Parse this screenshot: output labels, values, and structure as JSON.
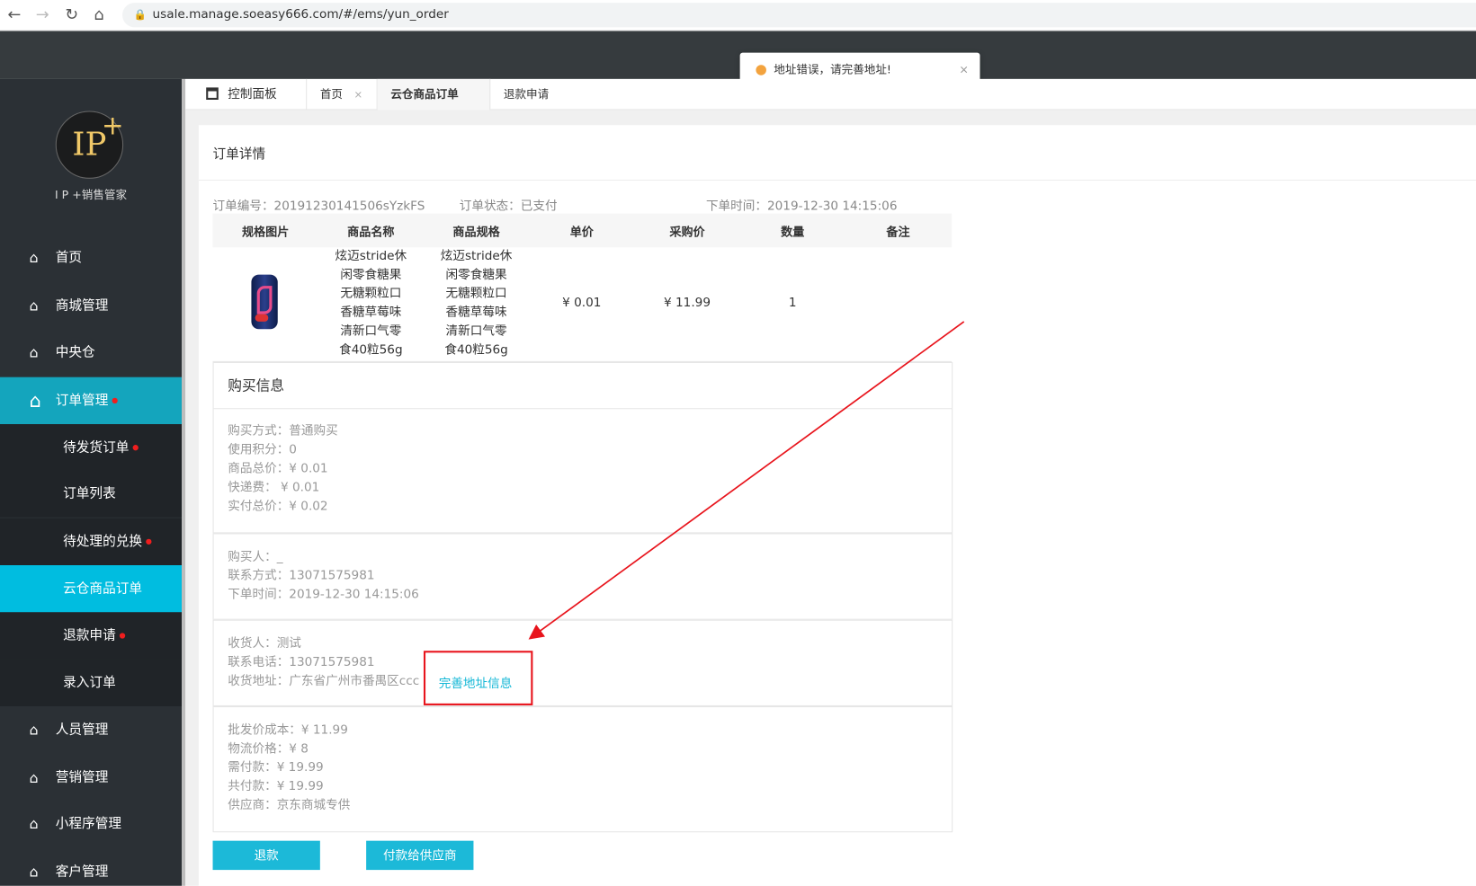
{
  "browser": {
    "url": "usale.manage.soeasy666.com/#/ems/yun_order"
  },
  "toast": {
    "message": "地址错误，请完善地址!",
    "close": "×",
    "color": "#f3a33e"
  },
  "logo": {
    "mark": "IP",
    "plus": "+",
    "name": "I P +销售管家"
  },
  "sidebar": {
    "items": [
      {
        "label": "首页",
        "icon": "home-icon"
      },
      {
        "label": "商城管理",
        "icon": "home-icon"
      },
      {
        "label": "中央仓",
        "icon": "home-icon"
      },
      {
        "label": "订单管理",
        "icon": "home-icon",
        "active": true,
        "dot": true
      },
      {
        "label": "待发货订单",
        "sub": true,
        "dot": true
      },
      {
        "label": "订单列表",
        "sub": true
      },
      {
        "label": "待处理的兑换",
        "sub": true,
        "dot": true
      },
      {
        "label": "云仓商品订单",
        "sub": true,
        "active": true
      },
      {
        "label": "退款申请",
        "sub": true,
        "dot": true
      },
      {
        "label": "录入订单",
        "sub": true
      },
      {
        "label": "人员管理",
        "icon": "home-icon"
      },
      {
        "label": "营销管理",
        "icon": "home-icon"
      },
      {
        "label": "小程序管理",
        "icon": "home-icon"
      },
      {
        "label": "客户管理",
        "icon": "home-icon"
      }
    ],
    "active_color": "#14a5bd",
    "sub_active_color": "#00bde0"
  },
  "tabs": {
    "dashboard": "控制面板",
    "items": [
      {
        "label": "首页",
        "close": "×"
      },
      {
        "label": "云仓商品订单",
        "close": "×",
        "active": true
      },
      {
        "label": "退款申请",
        "close": "×"
      }
    ]
  },
  "page": {
    "title": "订单详情"
  },
  "order": {
    "number": "订单编号：20191230141506sYzkFS",
    "status": "订单状态：已支付",
    "time": "下单时间：2019-12-30 14:15:06"
  },
  "table": {
    "headers": [
      "规格图片",
      "商品名称",
      "商品规格",
      "单价",
      "采购价",
      "数量",
      "备注"
    ],
    "rows": [
      {
        "name": [
          "炫迈stride休",
          "闲零食糖果",
          "无糖颗粒口",
          "香糖草莓味",
          "清新口气零",
          "食40粒56g"
        ],
        "spec": [
          "炫迈stride休",
          "闲零食糖果",
          "无糖颗粒口",
          "香糖草莓味",
          "清新口气零",
          "食40粒56g"
        ],
        "price": "¥ 0.01",
        "purchase": "¥ 11.99",
        "qty": "1",
        "remark": ""
      }
    ]
  },
  "purchase": {
    "title": "购买信息",
    "lines": [
      "购买方式：普通购买",
      "使用积分：0",
      "商品总价：¥ 0.01",
      "快递费： ¥ 0.01",
      "实付总价：¥ 0.02"
    ]
  },
  "buyer": {
    "lines": [
      "购买人：_",
      "联系方式：13071575981",
      "下单时间：2019-12-30 14:15:06"
    ]
  },
  "receiver": {
    "lines": [
      "收货人：测试",
      "联系电话：13071575981",
      "收货地址：广东省广州市番禺区ccc"
    ],
    "complete_link": "完善地址信息"
  },
  "cost": {
    "lines": [
      "批发价成本：¥ 11.99",
      "物流价格：¥ 8",
      "需付款：¥ 19.99",
      "共付款：¥ 19.99",
      "供应商：京东商城专供"
    ]
  },
  "buttons": {
    "refund": "退款",
    "pay_supplier": "付款给供应商",
    "color": "#1cb9d8"
  }
}
